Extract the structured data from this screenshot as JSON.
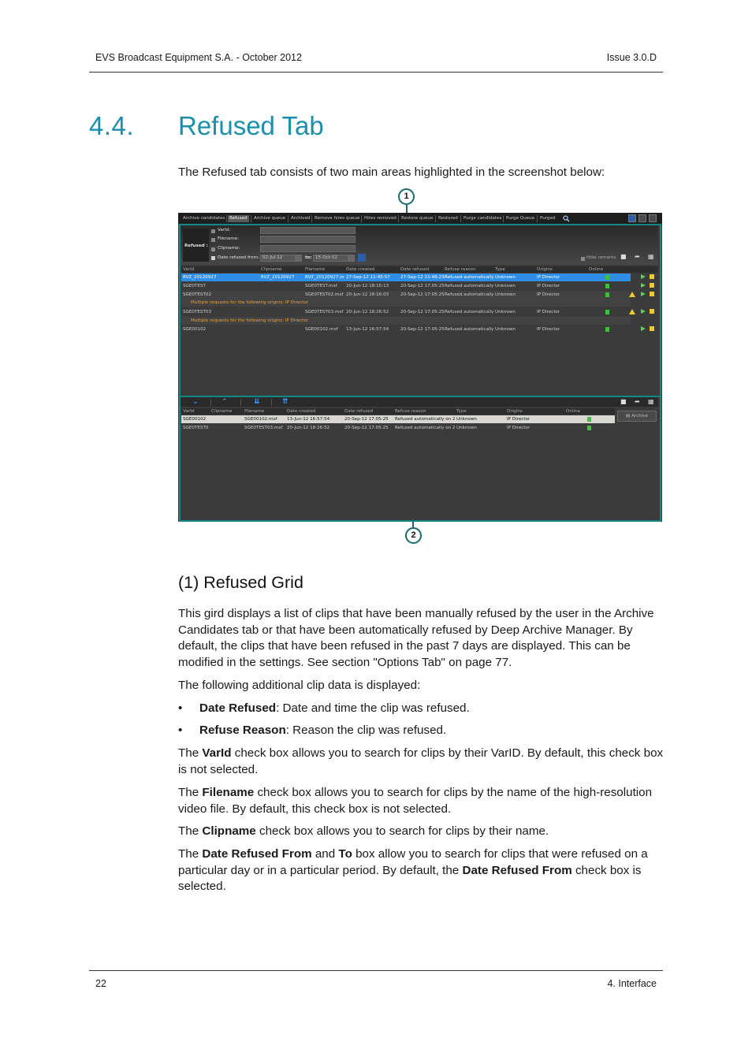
{
  "header": {
    "left": "EVS Broadcast Equipment S.A.  - October 2012",
    "right": "Issue 3.0.D"
  },
  "section": {
    "number": "4.4.",
    "title": "Refused Tab"
  },
  "intro": "The Refused tab consists of two main areas highlighted in the screenshot below:",
  "callouts": {
    "c1": "1",
    "c2": "2"
  },
  "screenshot": {
    "tabs": [
      "Archive candidates",
      "Refused",
      "Archive queue",
      "Archived",
      "Remove hires queue",
      "Hires removed",
      "Restore queue",
      "Restored",
      "Purge candidates",
      "Purge Queue",
      "Purged"
    ],
    "filter": {
      "refused_label": "Refused :",
      "varid": "VarId:",
      "filename": "Filename:",
      "clipname": "Clipname:",
      "date_from_label": "Date refused from:",
      "date_from": "02-Jul-12",
      "to_label": "to:",
      "date_to": "15-Oct-12",
      "hide_remarks": "Hide remarks"
    },
    "top_columns": [
      "VarId",
      "Clipname",
      "Filename",
      "Date created",
      "Date refused",
      "Refuse reason",
      "Type",
      "Origins",
      "Online"
    ],
    "top_rows": [
      {
        "varid": "RVZ_20120927",
        "clipname": "RVZ_20120927",
        "filename": "RVZ_20120927.mx",
        "created": "27-Sep-12 11:45:57",
        "refused": "27-Sep-12 11:46:23",
        "reason": "Refused automatically",
        "type": "Unknown",
        "origin": "IP Director"
      },
      {
        "varid": "SGE0TEST",
        "clipname": "",
        "filename": "SGE0TEST.mxf",
        "created": "20-Jun-12 18:15:13",
        "refused": "20-Sep-12 17:05:25",
        "reason": "Refused automatically",
        "type": "Unknown",
        "origin": "IP Director"
      },
      {
        "varid": "SGE0TEST02",
        "clipname": "",
        "filename": "SGE0TEST02.mxf",
        "created": "20-Jun-12 18:16:03",
        "refused": "20-Sep-12 17:05:25",
        "reason": "Refused automatically",
        "type": "Unknown",
        "origin": "IP Director"
      },
      {
        "varid": "SGE0TEST03",
        "clipname": "",
        "filename": "SGE0TEST03.mxf",
        "created": "20-Jun-12 18:26:52",
        "refused": "20-Sep-12 17:05:25",
        "reason": "Refused automatically",
        "type": "Unknown",
        "origin": "IP Director"
      },
      {
        "varid": "SGE00102",
        "clipname": "",
        "filename": "SGE00102.mxf",
        "created": "13-Jun-12 16:57:54",
        "refused": "20-Sep-12 17:05:25",
        "reason": "Refused automatically",
        "type": "Unknown",
        "origin": "IP Director"
      }
    ],
    "multi_note": "Multiple requests for the following origins: IP Director",
    "bottom_columns": [
      "VarId",
      "Clipname",
      "Filename",
      "Date created",
      "Date refused",
      "Refuse reason",
      "Type",
      "Origins",
      "Online"
    ],
    "bottom_rows": [
      {
        "varid": "SGE00102",
        "clipname": "",
        "filename": "SGE00102.mxf",
        "created": "13-Jun-12 16:57:54",
        "refused": "20-Sep-12 17:05:25",
        "reason": "Refused automatically on 2C",
        "type": "Unknown",
        "origin": "IP Director"
      },
      {
        "varid": "SGE0TEST0",
        "clipname": "",
        "filename": "SGE0TEST03.mxf",
        "created": "20-Jun-12 18:26:52",
        "refused": "20-Sep-12 17:05:25",
        "reason": "Refused automatically on 2C",
        "type": "Unknown",
        "origin": "IP Director"
      }
    ],
    "archive_button": "Archive"
  },
  "subsection": "(1) Refused Grid",
  "p1": "This gird displays a list of clips that have been manually refused by the user in the Archive Candidates tab or that have been automatically refused by Deep Archive Manager. By default, the clips that have been refused in the past 7 days are displayed. This can be modified in the settings. See section \"Options Tab\" on page 77.",
  "p2": "The following additional clip data is displayed:",
  "bullets": [
    {
      "term": "Date Refused",
      "rest": ": Date and time the clip was refused."
    },
    {
      "term": "Refuse Reason",
      "rest": ": Reason the clip was refused."
    }
  ],
  "p3": {
    "a": "The ",
    "b": "VarId",
    "c": " check box allows you to search for clips by their VarID. By default, this check box is not selected."
  },
  "p4": {
    "a": "The ",
    "b": "Filename",
    "c": " check box allows you to search for clips by the name of the high-resolution video file. By default, this check box is not selected."
  },
  "p5": {
    "a": "The ",
    "b": "Clipname",
    "c": " check box allows you to search for clips by their name."
  },
  "p6": {
    "a": "The ",
    "b": "Date Refused From",
    "c": " and ",
    "d": "To",
    "e": " box allow you to search for clips that were refused on a particular day or in a particular period. By default, the ",
    "f": "Date Refused From",
    "g": " check box is selected."
  },
  "footer": {
    "left": "22",
    "right": "4. Interface"
  }
}
